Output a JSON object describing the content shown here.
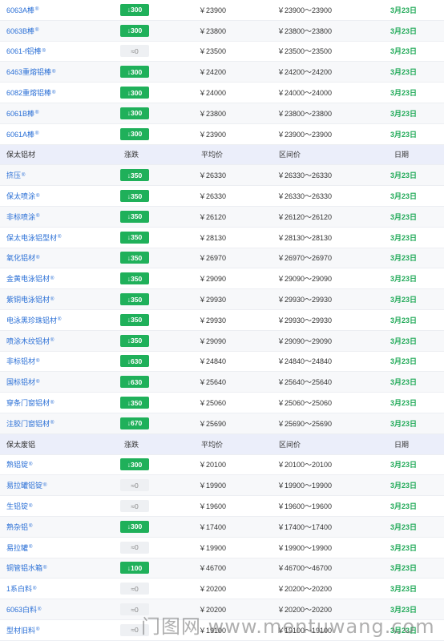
{
  "sections": [
    {
      "header": null,
      "rows": [
        {
          "name": "6063A棒",
          "change": "↓300",
          "change_type": "down",
          "avg": "￥23900",
          "range": "￥23900～23900",
          "date": "3月23日"
        },
        {
          "name": "6063B棒",
          "change": "↓300",
          "change_type": "down",
          "avg": "￥23800",
          "range": "￥23800～23800",
          "date": "3月23日"
        },
        {
          "name": "6061-f铝棒",
          "change": "≈0",
          "change_type": "flat",
          "avg": "￥23500",
          "range": "￥23500～23500",
          "date": "3月23日"
        },
        {
          "name": "6463重熔铝棒",
          "change": "↓300",
          "change_type": "down",
          "avg": "￥24200",
          "range": "￥24200～24200",
          "date": "3月23日"
        },
        {
          "name": "6082重熔铝棒",
          "change": "↓300",
          "change_type": "down",
          "avg": "￥24000",
          "range": "￥24000～24000",
          "date": "3月23日"
        },
        {
          "name": "6061B棒",
          "change": "↓300",
          "change_type": "down",
          "avg": "￥23800",
          "range": "￥23800～23800",
          "date": "3月23日"
        },
        {
          "name": "6061A棒",
          "change": "↓300",
          "change_type": "down",
          "avg": "￥23900",
          "range": "￥23900～23900",
          "date": "3月23日"
        }
      ]
    },
    {
      "header": {
        "name": "保太铝材",
        "change": "涨跌",
        "avg": "平均价",
        "range": "区间价",
        "date": "日期"
      },
      "rows": [
        {
          "name": "挤压",
          "change": "↓350",
          "change_type": "down",
          "avg": "￥26330",
          "range": "￥26330～26330",
          "date": "3月23日"
        },
        {
          "name": "保太喷涂",
          "change": "↓350",
          "change_type": "down",
          "avg": "￥26330",
          "range": "￥26330～26330",
          "date": "3月23日"
        },
        {
          "name": "非标喷涂",
          "change": "↓350",
          "change_type": "down",
          "avg": "￥26120",
          "range": "￥26120～26120",
          "date": "3月23日"
        },
        {
          "name": "保太电泳铝型材",
          "change": "↓350",
          "change_type": "down",
          "avg": "￥28130",
          "range": "￥28130～28130",
          "date": "3月23日"
        },
        {
          "name": "氧化铝材",
          "change": "↓350",
          "change_type": "down",
          "avg": "￥26970",
          "range": "￥26970～26970",
          "date": "3月23日"
        },
        {
          "name": "金黄电泳铝材",
          "change": "↓350",
          "change_type": "down",
          "avg": "￥29090",
          "range": "￥29090～29090",
          "date": "3月23日"
        },
        {
          "name": "紫铜电泳铝材",
          "change": "↓350",
          "change_type": "down",
          "avg": "￥29930",
          "range": "￥29930～29930",
          "date": "3月23日"
        },
        {
          "name": "电泳黑珍珠铝材",
          "change": "↓350",
          "change_type": "down",
          "avg": "￥29930",
          "range": "￥29930～29930",
          "date": "3月23日"
        },
        {
          "name": "喷涂木纹铝材",
          "change": "↓350",
          "change_type": "down",
          "avg": "￥29090",
          "range": "￥29090～29090",
          "date": "3月23日"
        },
        {
          "name": "非标铝材",
          "change": "↓630",
          "change_type": "down",
          "avg": "￥24840",
          "range": "￥24840～24840",
          "date": "3月23日"
        },
        {
          "name": "国标铝材",
          "change": "↓630",
          "change_type": "down",
          "avg": "￥25640",
          "range": "￥25640～25640",
          "date": "3月23日"
        },
        {
          "name": "穿条门窗铝材",
          "change": "↓350",
          "change_type": "down",
          "avg": "￥25060",
          "range": "￥25060～25060",
          "date": "3月23日"
        },
        {
          "name": "注胶门窗铝材",
          "change": "↓670",
          "change_type": "down",
          "avg": "￥25690",
          "range": "￥25690～25690",
          "date": "3月23日"
        }
      ]
    },
    {
      "header": {
        "name": "保太废铝",
        "change": "涨跌",
        "avg": "平均价",
        "range": "区间价",
        "date": "日期"
      },
      "rows": [
        {
          "name": "熟铝锭",
          "change": "↓300",
          "change_type": "down",
          "avg": "￥20100",
          "range": "￥20100～20100",
          "date": "3月23日"
        },
        {
          "name": "易拉罐铝锭",
          "change": "≈0",
          "change_type": "flat",
          "avg": "￥19900",
          "range": "￥19900～19900",
          "date": "3月23日"
        },
        {
          "name": "生铝锭",
          "change": "≈0",
          "change_type": "flat",
          "avg": "￥19600",
          "range": "￥19600～19600",
          "date": "3月23日"
        },
        {
          "name": "熟杂铝",
          "change": "↓300",
          "change_type": "down",
          "avg": "￥17400",
          "range": "￥17400～17400",
          "date": "3月23日"
        },
        {
          "name": "易拉罐",
          "change": "≈0",
          "change_type": "flat",
          "avg": "￥19900",
          "range": "￥19900～19900",
          "date": "3月23日"
        },
        {
          "name": "铜管铝水箱",
          "change": "↓100",
          "change_type": "down",
          "avg": "￥46700",
          "range": "￥46700～46700",
          "date": "3月23日"
        },
        {
          "name": "1系白料",
          "change": "≈0",
          "change_type": "flat",
          "avg": "￥20200",
          "range": "￥20200～20200",
          "date": "3月23日"
        },
        {
          "name": "6063白料",
          "change": "≈0",
          "change_type": "flat",
          "avg": "￥20200",
          "range": "￥20200～20200",
          "date": "3月23日"
        },
        {
          "name": "型材旧料",
          "change": "≈0",
          "change_type": "flat",
          "avg": "￥19100",
          "range": "￥19100～19100",
          "date": "3月23日"
        }
      ]
    }
  ],
  "reg_mark": "®",
  "watermark": "门图网 www.mentuwang.com",
  "colors": {
    "down": "#1fb05a",
    "date": "#1fa957",
    "link": "#2a6fd6",
    "header_bg": "#ebeefa"
  }
}
